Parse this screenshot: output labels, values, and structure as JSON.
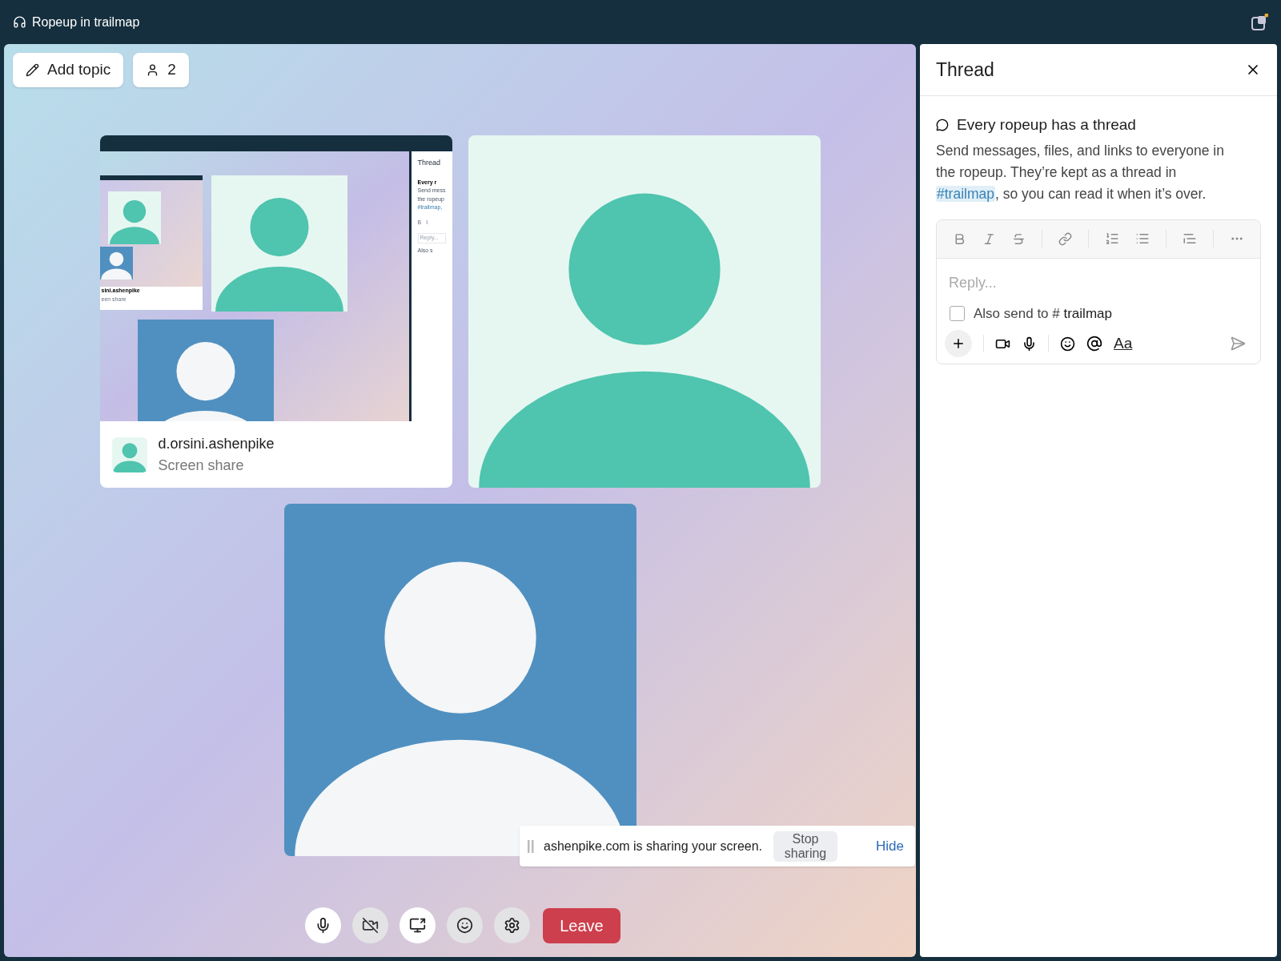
{
  "title_bar": {
    "title": "Ropeup in trailmap"
  },
  "stage": {
    "buttons": [
      {
        "kind": "topic",
        "label": "Add topic"
      },
      {
        "kind": "participants",
        "label": "2"
      }
    ],
    "tiles": [
      {
        "kind": "screen_share",
        "color": "#4fc4ae",
        "name": "d.orsini.ashenpike",
        "subtitle": "Screen share",
        "preview": {
          "thread_title": "Thread",
          "topic": "Every r",
          "body_lines": [
            "Send mess",
            "the ropeup"
          ],
          "channel": "#trailmap,",
          "format_buttons": [
            "B",
            "I"
          ],
          "placeholder": "Reply...",
          "checkbox_label": "Also s",
          "name": "sini.ashenpike",
          "subtitle": "een share"
        }
      },
      {
        "kind": "avatar",
        "color": "#4fc4ae"
      },
      {
        "kind": "avatar",
        "color": "#5090c0"
      }
    ],
    "share_notice": {
      "text": "ashenpike.com is sharing your screen.",
      "stop": "Stop sharing",
      "hide": "Hide"
    },
    "controls": [
      {
        "kind": "mic",
        "on": true
      },
      {
        "kind": "camera",
        "on": false
      },
      {
        "kind": "screen",
        "on": true
      },
      {
        "kind": "reactions",
        "on": false
      },
      {
        "kind": "settings",
        "on": false
      }
    ],
    "leave": "Leave"
  },
  "thread": {
    "title": "Thread",
    "heading": "Every ropeup has a thread",
    "body_start": "Send messages, files, and links to everyone in the ropeup. They’re kept as a thread in ",
    "channel": "#trailmap",
    "body_end": ", so you can read it when it’s over.",
    "composer": {
      "placeholder": "Reply...",
      "also_send": {
        "label": "Also send to #",
        "channel": "trailmap",
        "checked": false
      },
      "format": "Aa"
    }
  }
}
